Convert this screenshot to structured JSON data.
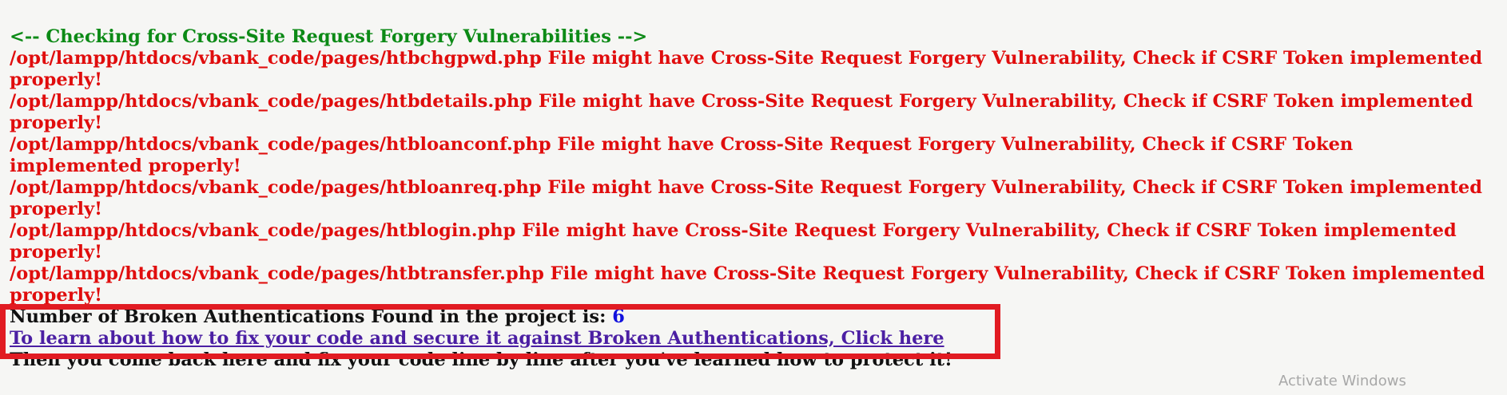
{
  "header": {
    "comment": "<-- Checking for Cross-Site Request Forgery Vulnerabilities -->"
  },
  "csrf_warnings": [
    "/opt/lampp/htdocs/vbank_code/pages/htbchgpwd.php File might have Cross-Site Request Forgery Vulnerability, Check if CSRF Token implemented properly!",
    "/opt/lampp/htdocs/vbank_code/pages/htbdetails.php File might have Cross-Site Request Forgery Vulnerability, Check if CSRF Token implemented properly!",
    "/opt/lampp/htdocs/vbank_code/pages/htbloanconf.php File might have Cross-Site Request Forgery Vulnerability, Check if CSRF Token implemented properly!",
    "/opt/lampp/htdocs/vbank_code/pages/htbloanreq.php File might have Cross-Site Request Forgery Vulnerability, Check if CSRF Token implemented properly!",
    "/opt/lampp/htdocs/vbank_code/pages/htblogin.php File might have Cross-Site Request Forgery Vulnerability, Check if CSRF Token implemented properly!",
    "/opt/lampp/htdocs/vbank_code/pages/htbtransfer.php File might have Cross-Site Request Forgery Vulnerability, Check if CSRF Token implemented properly!"
  ],
  "summary": {
    "label": "Number of Broken Authentications Found in the project is: ",
    "count": "6",
    "link_text": "To learn about how to fix your code and secure it against Broken Authentications, Click here",
    "followup": "Then you come back here and fix your code line by line after you've learned how to protect it!"
  },
  "watermark": "Activate Windows",
  "colors": {
    "header": "#0c8a16",
    "warning": "#e00d0d",
    "count": "#1111dd",
    "link": "#4b1fa3",
    "highlight_box": "#e11b22"
  }
}
